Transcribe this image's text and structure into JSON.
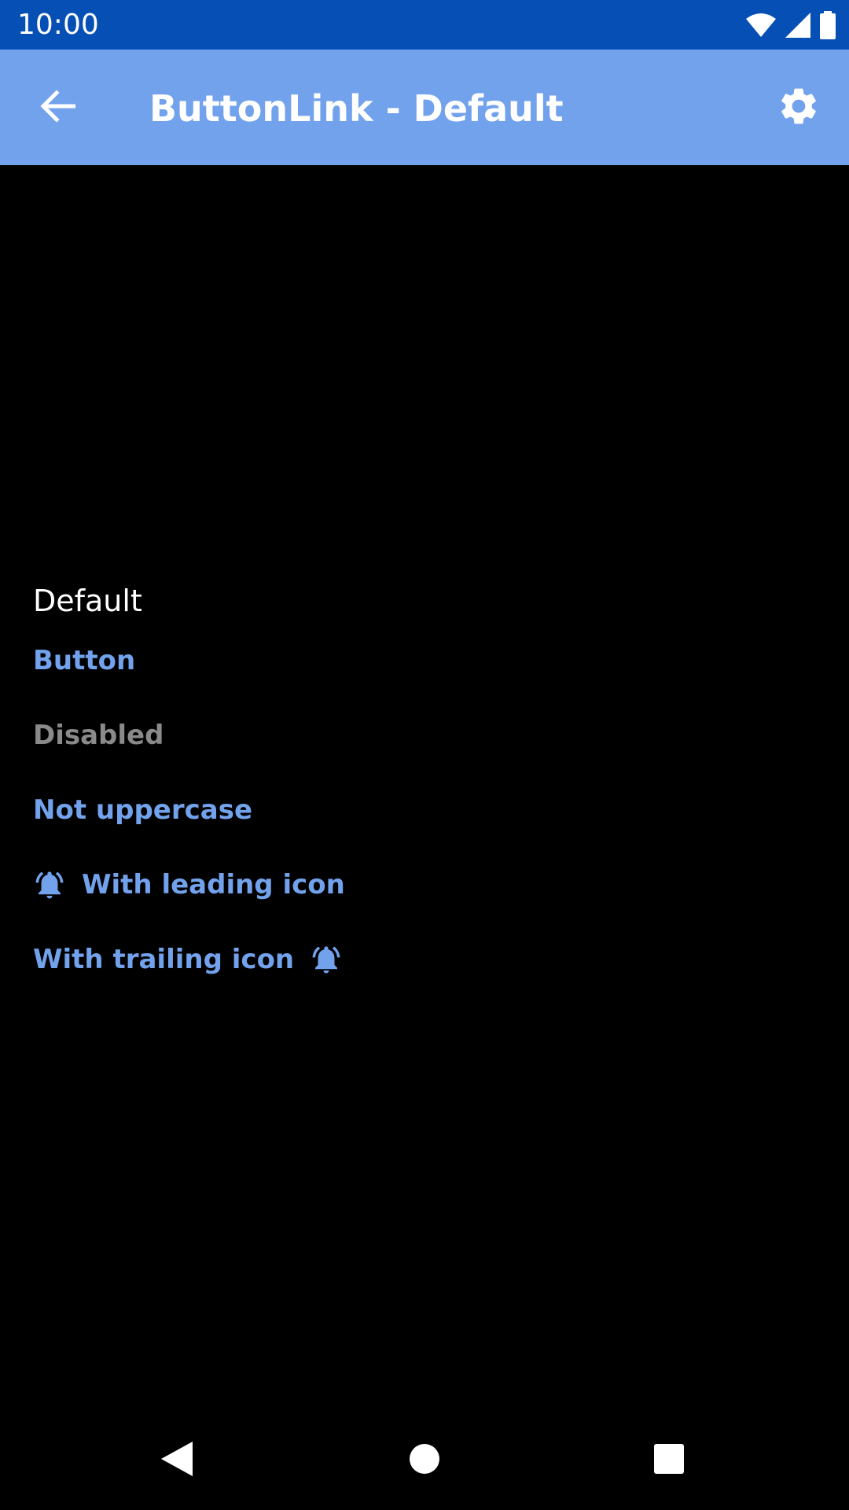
{
  "status_bar": {
    "time": "10:00",
    "background": "#054fb5",
    "icons": [
      "wifi-icon",
      "cell-signal-icon",
      "battery-icon"
    ]
  },
  "app_bar": {
    "title": "ButtonLink - Default",
    "background": "#72a2ec",
    "back_icon": "arrow-back-icon",
    "settings_icon": "gear-icon"
  },
  "content": {
    "section_label": "Default",
    "links": {
      "button": "Button",
      "disabled": "Disabled",
      "not_uppercase": "Not uppercase",
      "leading_icon": "With leading icon",
      "trailing_icon": "With trailing icon"
    },
    "link_color": "#72a2ec",
    "disabled_color": "#8a8a8a",
    "link_icon": "bell-ringing-icon"
  },
  "nav_bar": {
    "icons": [
      "nav-back-icon",
      "nav-home-icon",
      "nav-recents-icon"
    ]
  }
}
